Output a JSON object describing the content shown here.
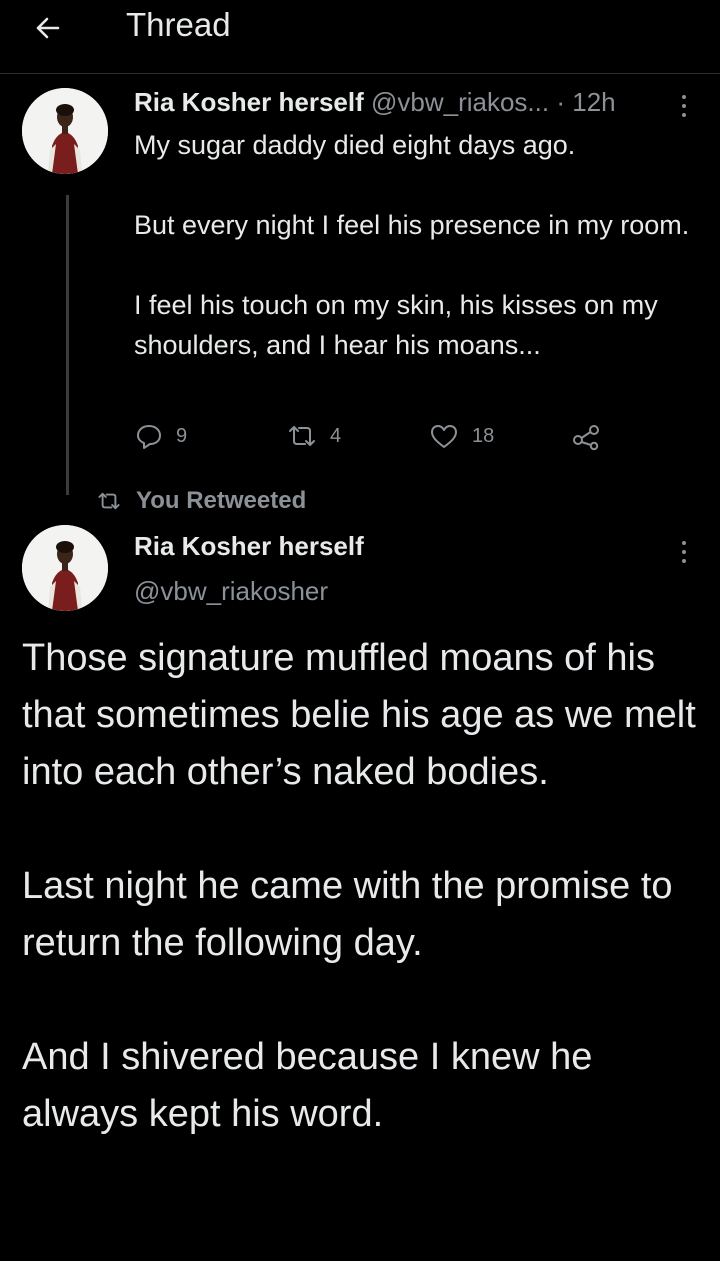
{
  "header": {
    "title": "Thread",
    "back_icon": "arrow-left-icon"
  },
  "colors": {
    "background": "#000000",
    "text": "#e7e9ea",
    "muted": "#8b9196",
    "divider": "#2a2d30"
  },
  "tweet1": {
    "author_name": "Ria Kosher herself",
    "handle": "@vbw_riakos...",
    "separator": "·",
    "time": "12h",
    "text": "My sugar daddy died eight days ago.\n\nBut every night I feel his presence in my room.\n\nI feel his touch on my skin, his kisses on my shoulders, and I hear his moans...",
    "actions": {
      "replies": "9",
      "retweets": "4",
      "likes": "18"
    }
  },
  "retweet_notice": {
    "label": "You Retweeted"
  },
  "tweet2": {
    "author_name": "Ria Kosher herself",
    "handle": "@vbw_riakosher",
    "text": "Those signature muffled moans of his that sometimes belie his age as we melt into each other’s naked bodies.\n\nLast night he came with the promise to return the following day.\n\nAnd I shivered because I knew he always kept his word."
  }
}
